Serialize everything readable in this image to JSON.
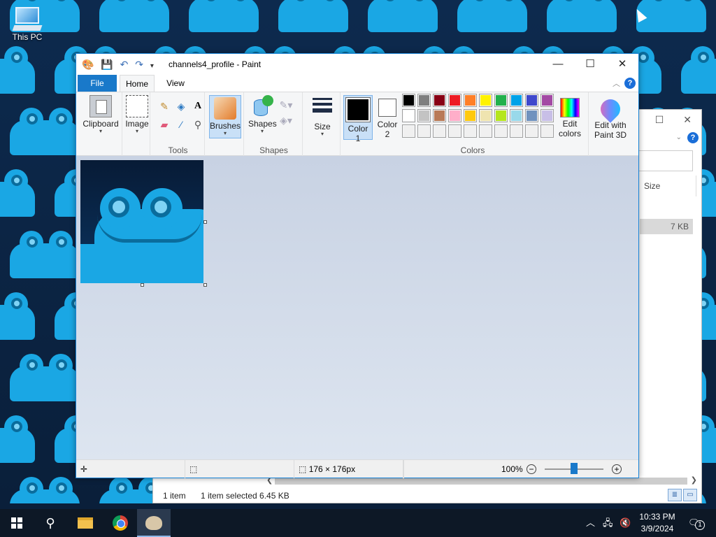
{
  "desktop": {
    "icons": [
      {
        "label": "This PC"
      }
    ]
  },
  "paint": {
    "title": "channels4_profile - Paint",
    "tabs": [
      {
        "label": "File"
      },
      {
        "label": "Home"
      },
      {
        "label": "View"
      }
    ],
    "groups": {
      "clipboard": {
        "label": "Clipboard"
      },
      "image": {
        "label": "Image"
      },
      "tools": {
        "label": "Tools"
      },
      "brushes": {
        "label": "Brushes"
      },
      "shapes": {
        "label": "Shapes",
        "group_label": "Shapes"
      },
      "size": {
        "label": "Size"
      },
      "color1": {
        "label_line1": "Color",
        "label_line2": "1"
      },
      "color2": {
        "label_line1": "Color",
        "label_line2": "2"
      },
      "colors_group": {
        "label": "Colors"
      },
      "edit_colors": {
        "label_line1": "Edit",
        "label_line2": "colors"
      },
      "paint3d": {
        "label_line1": "Edit with",
        "label_line2": "Paint 3D"
      }
    },
    "palette_row1": [
      "#000000",
      "#7f7f7f",
      "#880015",
      "#ed1c24",
      "#ff7f27",
      "#fff200",
      "#22b14c",
      "#00a2e8",
      "#3f48cc",
      "#a349a4"
    ],
    "palette_row2": [
      "#ffffff",
      "#c3c3c3",
      "#b97a57",
      "#ffaec9",
      "#ffc90e",
      "#efe4b0",
      "#b5e61d",
      "#99d9ea",
      "#7092be",
      "#c8bfe7"
    ],
    "palette_row3": [
      "#f0f0f0",
      "#f0f0f0",
      "#f0f0f0",
      "#f0f0f0",
      "#f0f0f0",
      "#f0f0f0",
      "#f0f0f0",
      "#f0f0f0",
      "#f0f0f0",
      "#f0f0f0"
    ],
    "accent_color": "#1979ca",
    "status": {
      "image_size": "176 × 176px",
      "zoom": "100%",
      "zoom_fraction": 0.5
    }
  },
  "explorer": {
    "column_size": "Size",
    "row_size": "7 KB",
    "status_items": "1 item",
    "status_selected": "1 item selected  6.45 KB"
  },
  "taskbar": {
    "time": "10:33 PM",
    "date": "3/9/2024",
    "notifications": "1"
  }
}
